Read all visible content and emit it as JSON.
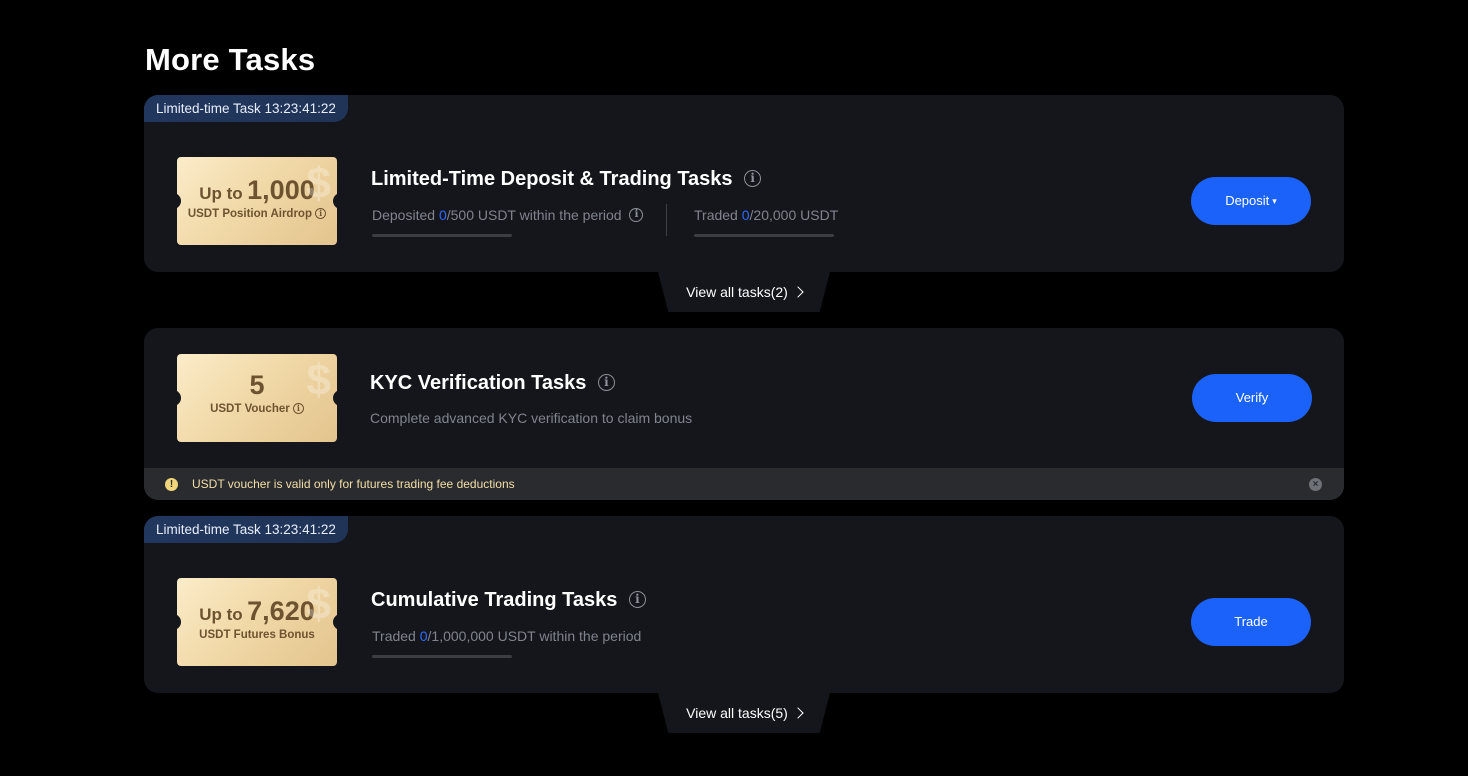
{
  "page": {
    "title": "More Tasks"
  },
  "tasks": [
    {
      "tag": "Limited-time Task 13:23:41:22",
      "reward": {
        "prefix": "Up to",
        "amount": "1,000",
        "label": "USDT Position Airdrop"
      },
      "title": "Limited-Time Deposit & Trading Tasks",
      "progress": [
        {
          "label": "Deposited",
          "current": "0",
          "rest": "/500 USDT within the period",
          "fraction": 0
        },
        {
          "label": "Traded",
          "current": "0",
          "rest": "/20,000 USDT",
          "fraction": 0
        }
      ],
      "button": {
        "label": "Deposit",
        "caret": "▾"
      },
      "view_all": "View all tasks(2)"
    },
    {
      "reward": {
        "amount": "5",
        "label": "USDT Voucher"
      },
      "title": "KYC Verification Tasks",
      "description": "Complete advanced KYC verification to claim bonus",
      "button": {
        "label": "Verify"
      },
      "notice": "USDT voucher is valid only for futures trading fee deductions"
    },
    {
      "tag": "Limited-time Task 13:23:41:22",
      "reward": {
        "prefix": "Up to",
        "amount": "7,620",
        "label": "USDT Futures Bonus"
      },
      "title": "Cumulative Trading Tasks",
      "progress": [
        {
          "label": "Traded",
          "current": "0",
          "rest": "/1,000,000 USDT within the period",
          "fraction": 0
        }
      ],
      "button": {
        "label": "Trade"
      },
      "view_all": "View all tasks(5)"
    }
  ],
  "colors": {
    "accent": "#1b62fb",
    "highlight": "#2e6bff",
    "card_bg": "#15161b",
    "ticket_gold": "#f1d9a8"
  },
  "icons": [
    "info-icon",
    "chevron-right-icon",
    "warning-icon",
    "close-icon",
    "caret-down-icon"
  ]
}
